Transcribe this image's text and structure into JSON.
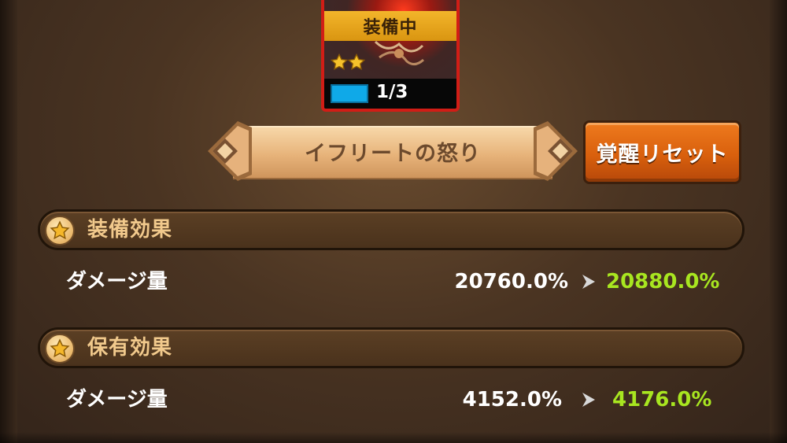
{
  "card": {
    "status_banner": "装備中",
    "star_count": 2,
    "level_text": "1/3",
    "level_progress": 0.3333
  },
  "skill_name": "イフリートの怒り",
  "reset_button_label": "覚醒リセット",
  "sections": [
    {
      "title": "装備効果",
      "icon": "star-icon",
      "stat": {
        "label": "ダメージ量",
        "old_value": "20760.0%",
        "new_value": "20880.0%"
      }
    },
    {
      "title": "保有効果",
      "icon": "star-icon",
      "stat": {
        "label": "ダメージ量",
        "old_value": "4152.0%",
        "new_value": "4176.0%"
      }
    }
  ],
  "colors": {
    "new_value": "#a8e620",
    "banner": "#e6a318",
    "reset_button": "#e06a15",
    "level_fill": "#0fa9e8"
  }
}
